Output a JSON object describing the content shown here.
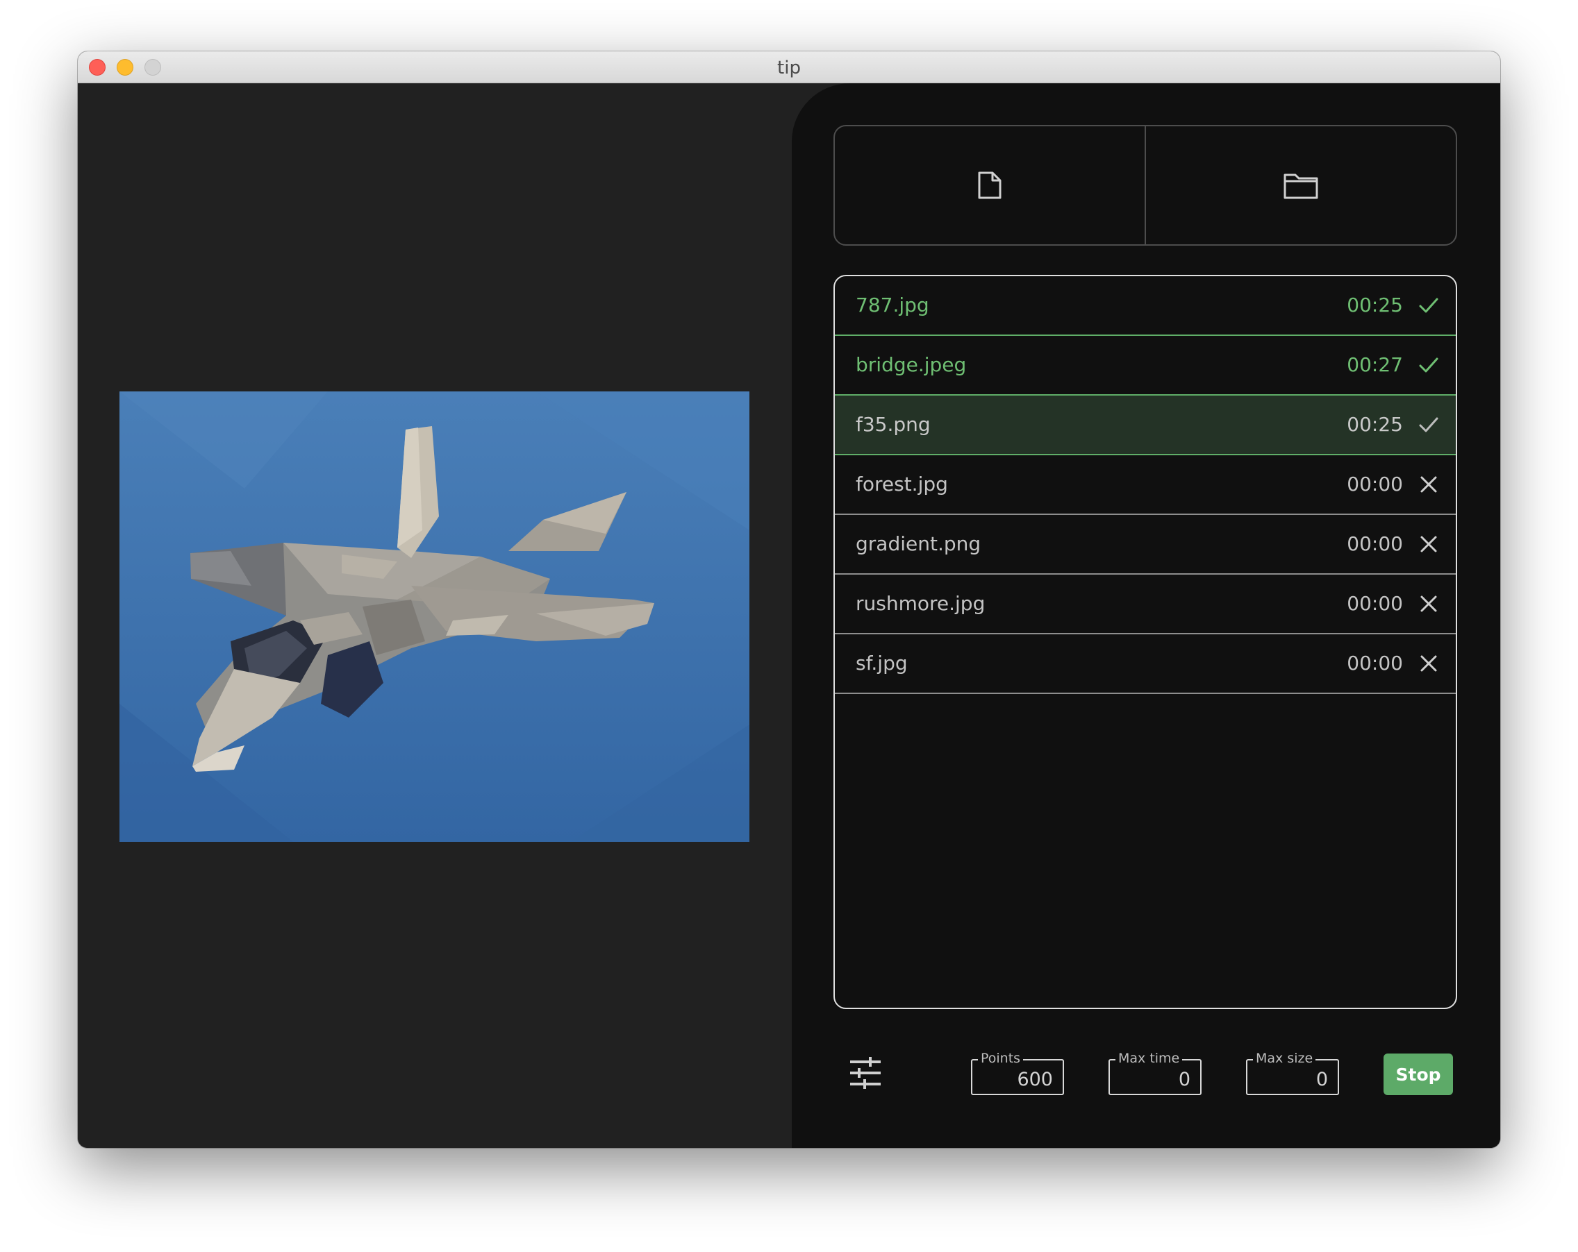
{
  "window": {
    "title": "tip"
  },
  "toolbar": {
    "open_file_icon": "file-icon",
    "open_folder_icon": "folder-icon"
  },
  "files": [
    {
      "name": "787.jpg",
      "time": "00:25",
      "status": "done",
      "selected": false
    },
    {
      "name": "bridge.jpeg",
      "time": "00:27",
      "status": "done",
      "selected": false
    },
    {
      "name": "f35.png",
      "time": "00:25",
      "status": "done",
      "selected": true
    },
    {
      "name": "forest.jpg",
      "time": "00:00",
      "status": "failed",
      "selected": false
    },
    {
      "name": "gradient.png",
      "time": "00:00",
      "status": "failed",
      "selected": false
    },
    {
      "name": "rushmore.jpg",
      "time": "00:00",
      "status": "failed",
      "selected": false
    },
    {
      "name": "sf.jpg",
      "time": "00:00",
      "status": "failed",
      "selected": false
    }
  ],
  "settings": {
    "points_label": "Points",
    "points_value": "600",
    "max_time_label": "Max time",
    "max_time_value": "0",
    "max_size_label": "Max size",
    "max_size_value": "0",
    "stop_label": "Stop"
  },
  "colors": {
    "accent_green": "#5daa68",
    "done_text": "#6fbf73",
    "selected_row": "#243326",
    "panel_bg": "#101010",
    "app_bg": "#212121"
  }
}
